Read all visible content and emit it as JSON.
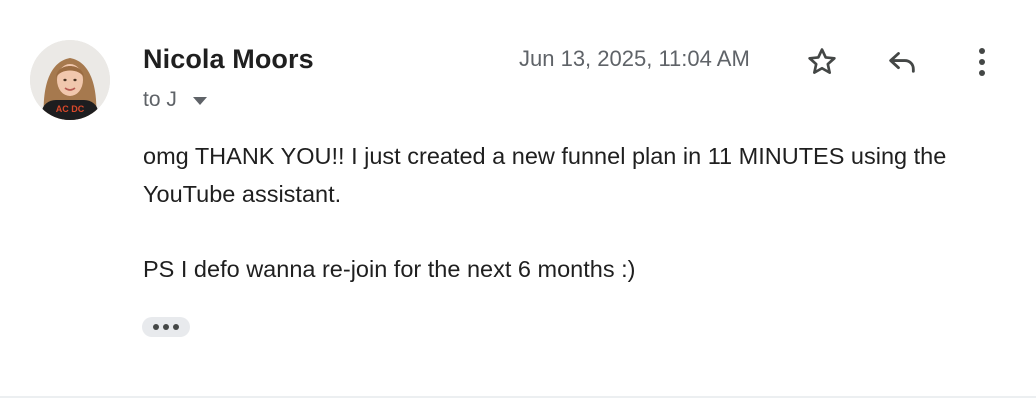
{
  "message": {
    "sender_name": "Nicola Moors",
    "recipient_label": "to J",
    "date": "Jun 13, 2025, 11:04 AM",
    "body_lines": [
      "omg THANK YOU!! I just created a new funnel plan in 11 MINUTES using the YouTube assistant.",
      "PS I defo wanna re-join for the next 6 months :)"
    ]
  },
  "icons": {
    "avatar": "avatar-photo",
    "recipient_toggle": "caret-down-icon",
    "star": "star-outline-icon",
    "reply": "reply-arrow-icon",
    "more": "more-vertical-icon",
    "trimmed": "ellipsis-icon"
  },
  "colors": {
    "text": "#1f1f1f",
    "secondary": "#5f6368",
    "chip_bg": "#e8eaed"
  }
}
